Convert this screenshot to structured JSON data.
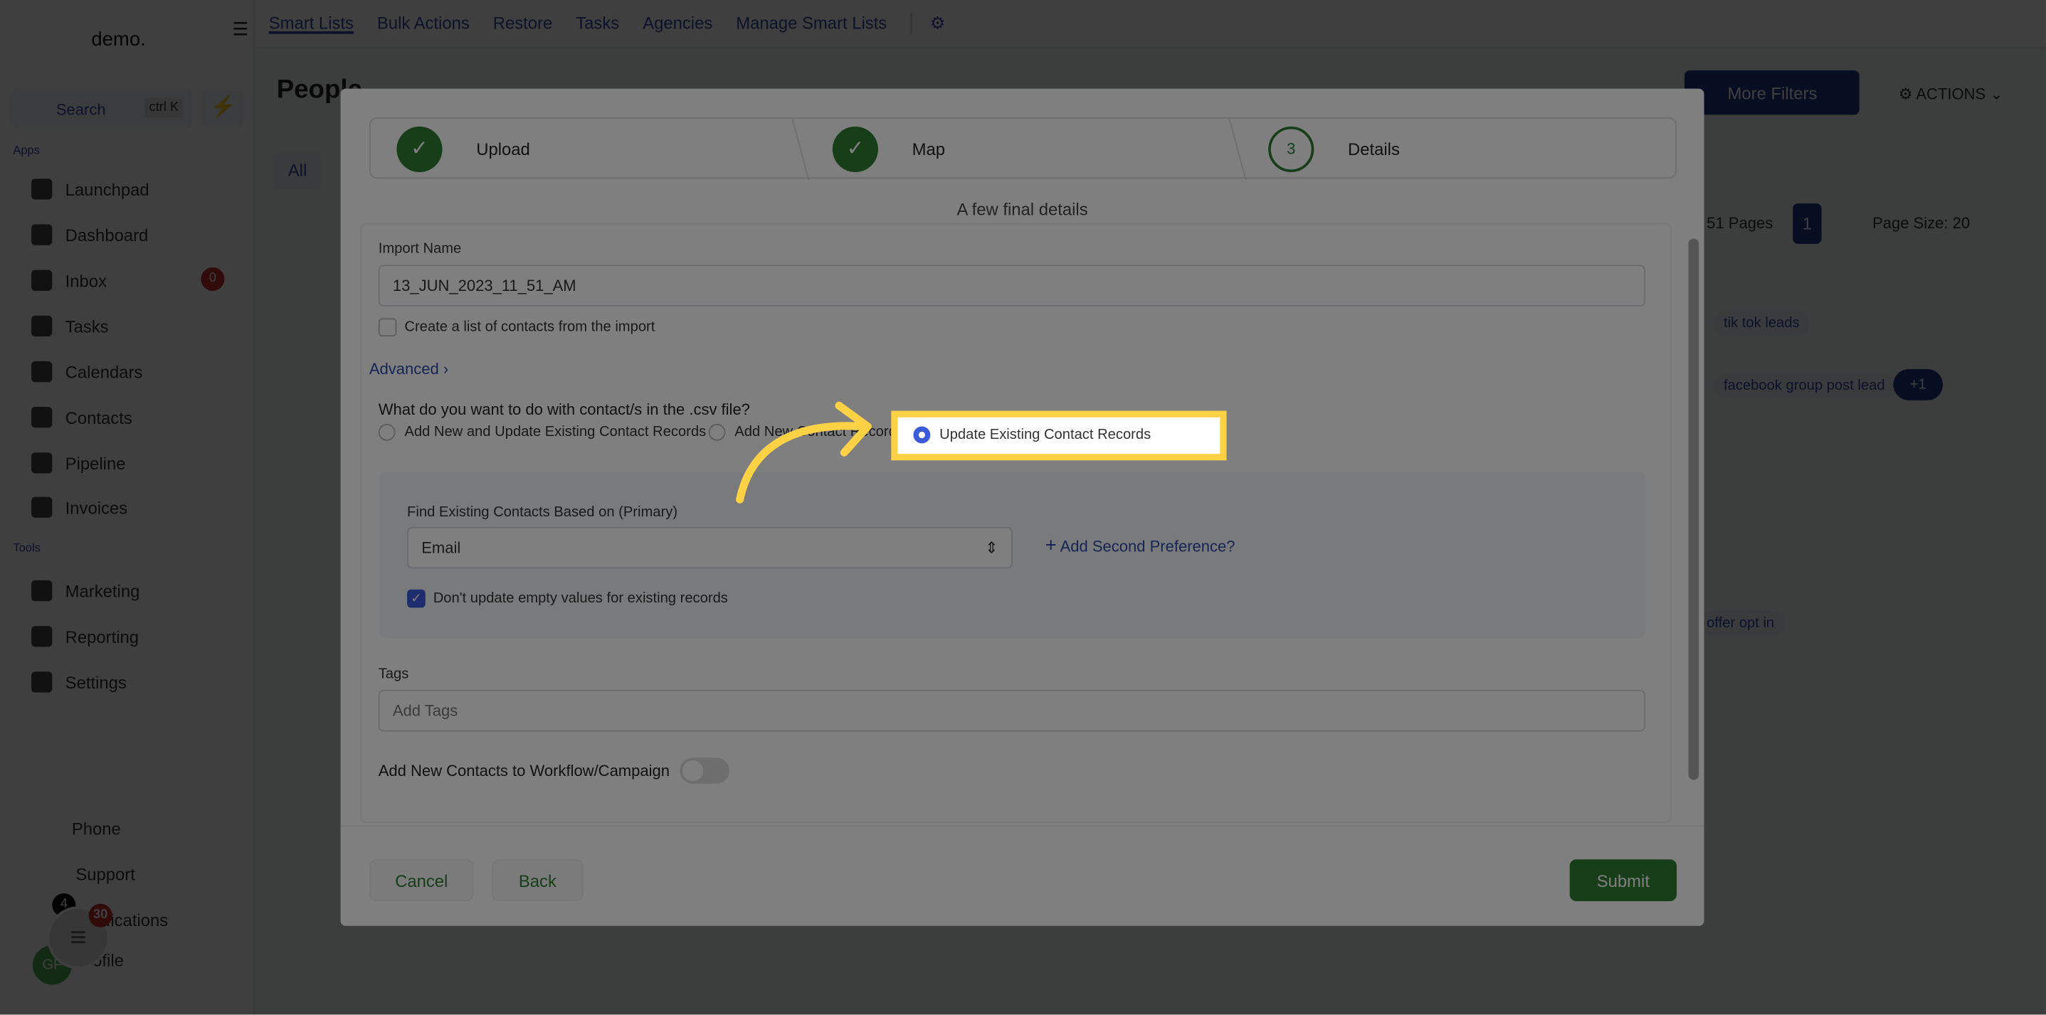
{
  "sidebar": {
    "logo": "demo.",
    "search": "Search",
    "shortcut": "ctrl K",
    "apps_label": "Apps",
    "tools_label": "Tools",
    "apps": [
      "Launchpad",
      "Dashboard",
      "Inbox",
      "Tasks",
      "Calendars",
      "Contacts",
      "Pipeline",
      "Invoices"
    ],
    "inbox_badge": "0",
    "tools": [
      "Marketing",
      "Reporting",
      "Settings"
    ],
    "bottom": [
      "Phone",
      "Support",
      "Notifications",
      "Profile"
    ],
    "notif_badge": "4",
    "chat_badge": "30",
    "avatar": "GF"
  },
  "topnav": [
    "Smart Lists",
    "Bulk Actions",
    "Restore",
    "Tasks",
    "Agencies",
    "Manage Smart Lists"
  ],
  "page": {
    "title": "People",
    "all_tab": "All",
    "more_filters": "More Filters",
    "actions": "ACTIONS",
    "pages": "51 Pages",
    "current_page": "1",
    "page_size": "Page Size: 20",
    "tags": [
      "tik tok leads",
      "facebook group post lead",
      "+1",
      "offer opt in"
    ]
  },
  "modal": {
    "steps": [
      {
        "label": "Upload",
        "status": "done"
      },
      {
        "label": "Map",
        "status": "done"
      },
      {
        "number": "3",
        "label": "Details",
        "status": "active"
      }
    ],
    "subtitle": "A few final details",
    "import_name_label": "Import Name",
    "import_name_value": "13_JUN_2023_11_51_AM",
    "create_list": "Create a list of contacts from the import",
    "advanced": "Advanced",
    "question": "What do you want to do with contact/s in the .csv file?",
    "options": [
      "Add New and Update Existing Contact Records",
      "Add New Contact Records",
      "Update Existing Contact Records"
    ],
    "selected_option": "Update Existing Contact Records",
    "find_label": "Find Existing Contacts Based on (Primary)",
    "find_value": "Email",
    "add_second": "Add Second Preference?",
    "dont_update": "Don't update empty values for existing records",
    "tags_label": "Tags",
    "tags_placeholder": "Add Tags",
    "workflow_label": "Add New Contacts to Workflow/Campaign",
    "cancel": "Cancel",
    "back": "Back",
    "submit": "Submit"
  },
  "colors": {
    "accent": "#2c4aa6",
    "success": "#2e7d32",
    "highlight": "#ffd245"
  }
}
